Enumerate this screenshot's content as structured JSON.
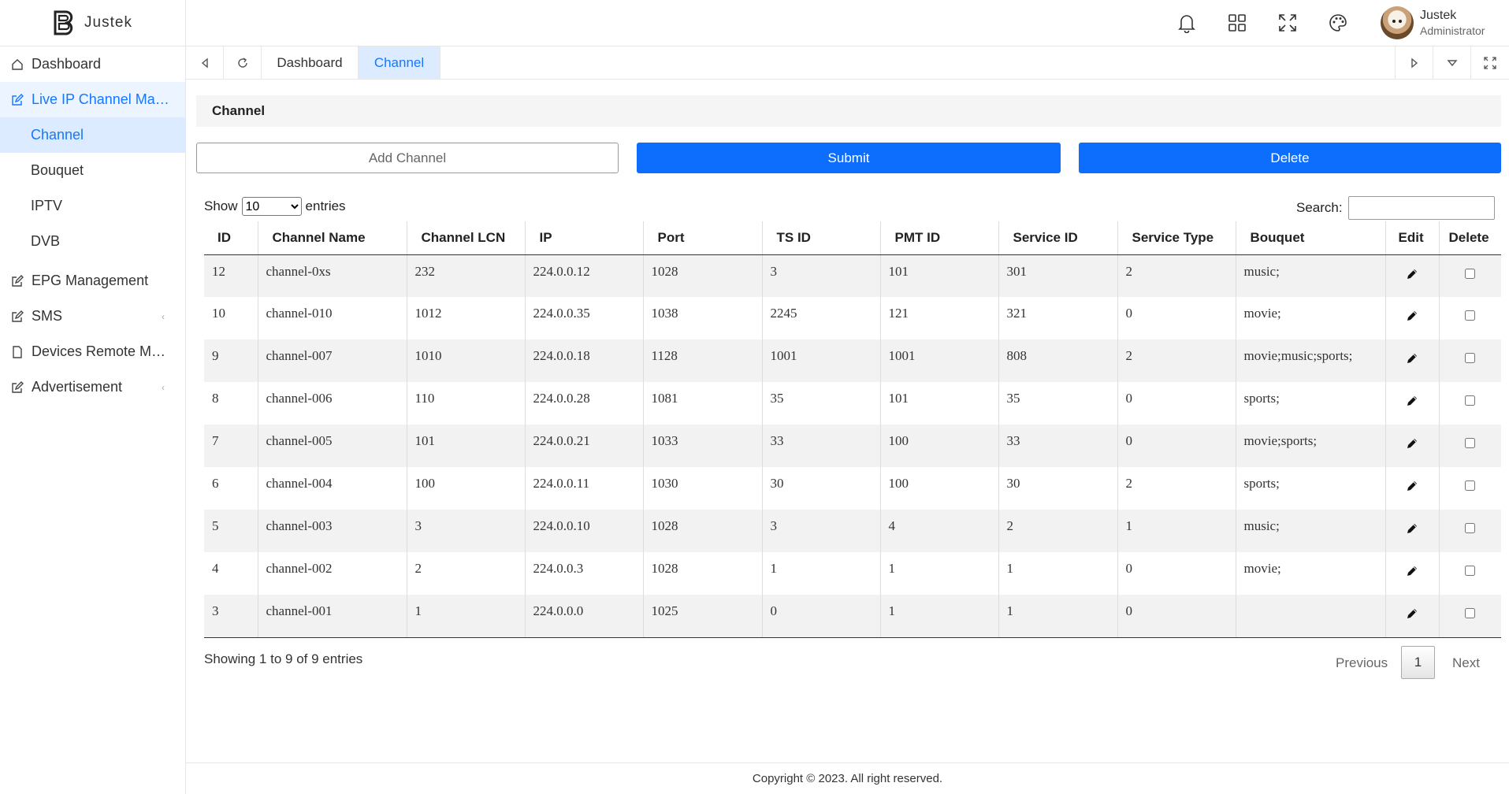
{
  "brand": {
    "name": "Justek"
  },
  "sidebar": {
    "items": [
      {
        "label": "Dashboard"
      },
      {
        "label": "Live IP Channel Man..."
      },
      {
        "label": "Channel"
      },
      {
        "label": "Bouquet"
      },
      {
        "label": "IPTV"
      },
      {
        "label": "DVB"
      },
      {
        "label": "EPG Management"
      },
      {
        "label": "SMS"
      },
      {
        "label": "Devices Remote Ma..."
      },
      {
        "label": "Advertisement"
      }
    ]
  },
  "header": {
    "icons": [
      "bell-icon",
      "apps-grid-icon",
      "fullscreen-icon",
      "palette-icon"
    ],
    "user": {
      "name": "Justek",
      "role": "Administrator"
    }
  },
  "tabs": [
    {
      "label": "Dashboard"
    },
    {
      "label": "Channel"
    }
  ],
  "panel": {
    "title": "Channel"
  },
  "actions": {
    "add_label": "Add Channel",
    "submit_label": "Submit",
    "delete_label": "Delete"
  },
  "table_controls": {
    "show_label": "Show",
    "entries_label": "entries",
    "length_value": "10",
    "search_label": "Search:"
  },
  "table": {
    "columns": [
      "ID",
      "Channel Name",
      "Channel LCN",
      "IP",
      "Port",
      "TS ID",
      "PMT ID",
      "Service ID",
      "Service Type",
      "Bouquet",
      "Edit",
      "Delete"
    ],
    "rows": [
      [
        "12",
        "channel-0xs",
        "232",
        "224.0.0.12",
        "1028",
        "3",
        "101",
        "301",
        "2",
        "music;"
      ],
      [
        "10",
        "channel-010",
        "1012",
        "224.0.0.35",
        "1038",
        "2245",
        "121",
        "321",
        "0",
        "movie;"
      ],
      [
        "9",
        "channel-007",
        "1010",
        "224.0.0.18",
        "1128",
        "1001",
        "1001",
        "808",
        "2",
        "movie;music;sports;"
      ],
      [
        "8",
        "channel-006",
        "110",
        "224.0.0.28",
        "1081",
        "35",
        "101",
        "35",
        "0",
        "sports;"
      ],
      [
        "7",
        "channel-005",
        "101",
        "224.0.0.21",
        "1033",
        "33",
        "100",
        "33",
        "0",
        "movie;sports;"
      ],
      [
        "6",
        "channel-004",
        "100",
        "224.0.0.11",
        "1030",
        "30",
        "100",
        "30",
        "2",
        "sports;"
      ],
      [
        "5",
        "channel-003",
        "3",
        "224.0.0.10",
        "1028",
        "3",
        "4",
        "2",
        "1",
        "music;"
      ],
      [
        "4",
        "channel-002",
        "2",
        "224.0.0.3",
        "1028",
        "1",
        "1",
        "1",
        "0",
        "movie;"
      ],
      [
        "3",
        "channel-001",
        "1",
        "224.0.0.0",
        "1025",
        "0",
        "1",
        "1",
        "0",
        ""
      ]
    ]
  },
  "pagination": {
    "info": "Showing 1 to 9 of 9 entries",
    "previous": "Previous",
    "page": "1",
    "next": "Next"
  },
  "footer": {
    "text": "Copyright © 2023. All right reserved."
  },
  "colors": {
    "accent": "#1677ff",
    "primary_button": "#0d6efd"
  }
}
